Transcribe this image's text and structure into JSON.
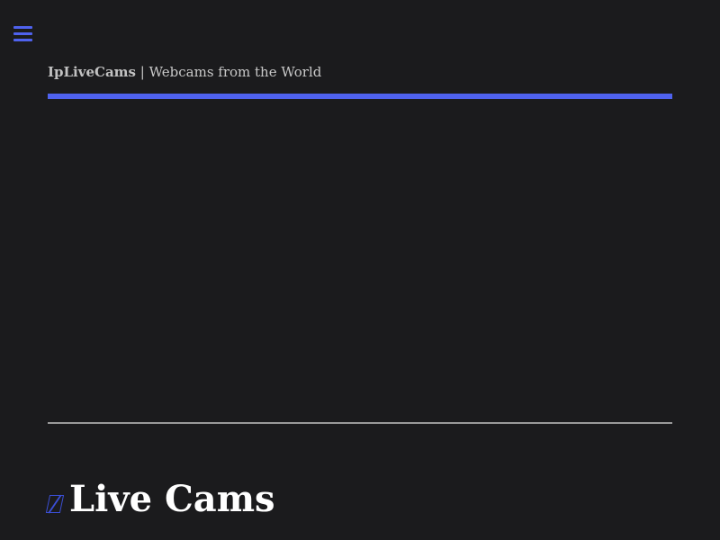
{
  "header": {
    "brand": "IpLiveCams",
    "separator": " | ",
    "tagline": "Webcams from the World",
    "accent_color": "#4f62ee"
  },
  "menu": {
    "icon": "hamburger-menu-icon"
  },
  "main": {
    "title_icon": "webcam-icon",
    "title": "Live Cams"
  }
}
